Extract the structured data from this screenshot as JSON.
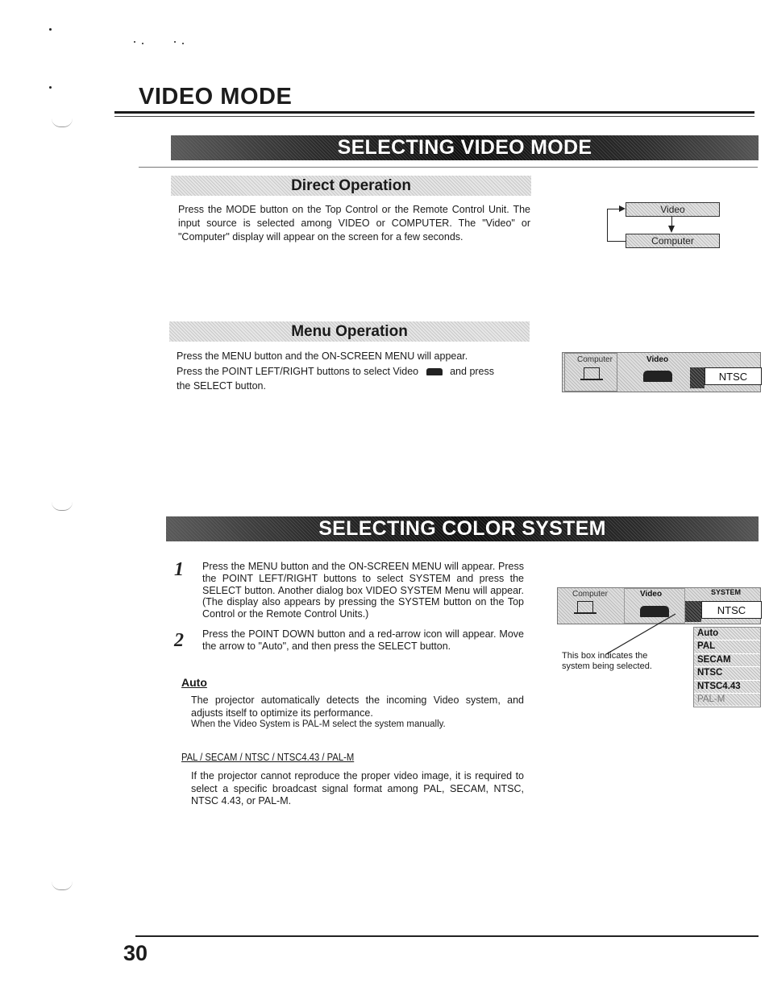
{
  "page": {
    "section_title": "VIDEO MODE",
    "page_number": "30"
  },
  "video_mode": {
    "banner": "SELECTING VIDEO MODE",
    "direct_operation": {
      "heading": "Direct Operation",
      "text": "Press the MODE button on the Top Control or the Remote Control Unit. The  input source is selected among VIDEO or COMPUTER.  The \"Video\" or \"Computer\" display will appear on the screen for a few seconds.",
      "diagram": {
        "top_box": "Video",
        "bottom_box": "Computer"
      }
    },
    "menu_operation": {
      "heading": "Menu Operation",
      "text_line1": "Press the MENU button and the ON-SCREEN MENU will appear.",
      "text_line2_before_icon": "Press the POINT LEFT/RIGHT buttons to select Video",
      "text_line2_after_icon": "and press",
      "text_line3": "the SELECT button.",
      "osd": {
        "tab_computer": "Computer",
        "tab_video": "Video",
        "value": "NTSC"
      }
    }
  },
  "color_system": {
    "banner": "SELECTING COLOR SYSTEM",
    "steps": [
      {
        "number": "1",
        "text": "Press the MENU button and the ON-SCREEN MENU will appear. Press the POINT LEFT/RIGHT buttons to select SYSTEM and press the SELECT button.  Another dialog box VIDEO SYSTEM Menu will appear.  (The display also appears by pressing the SYSTEM button on the Top Control or the Remote Control Units.)"
      },
      {
        "number": "2",
        "text": "Press the POINT DOWN button and a red-arrow icon will appear. Move the arrow to \"Auto\", and then press the SELECT button."
      }
    ],
    "osd": {
      "tab_computer": "Computer",
      "tab_video": "Video",
      "tab_system": "SYSTEM",
      "value": "NTSC",
      "options": [
        "Auto",
        "PAL",
        "SECAM",
        "NTSC",
        "NTSC4.43",
        "PAL-M"
      ]
    },
    "caption": "This box indicates the system being selected.",
    "auto": {
      "heading": "Auto",
      "line1": "The projector automatically detects the incoming Video system, and adjusts itself to optimize its performance.",
      "line2": "When the Video System is PAL-M select the system manually."
    },
    "manual": {
      "heading": "PAL / SECAM / NTSC / NTSC4.43 / PAL-M",
      "text": "If the projector cannot reproduce the proper video image, it is required to select a specific broadcast signal format among PAL, SECAM, NTSC, NTSC 4.43, or PAL-M."
    }
  }
}
